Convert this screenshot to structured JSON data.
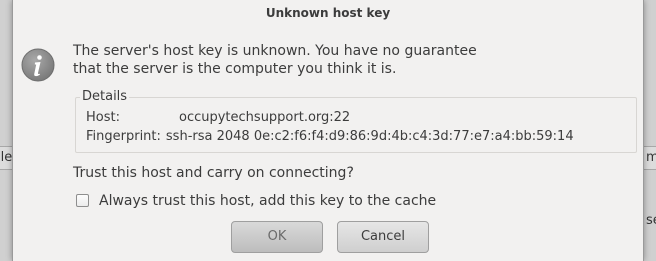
{
  "dialog": {
    "title": "Unknown host key",
    "message_line1": "The server's host key is unknown. You have no guarantee",
    "message_line2": "that the server is the computer you think it is.",
    "details": {
      "legend": "Details",
      "host_label": "Host:",
      "host_value": "occupytechsupport.org:22",
      "fingerprint_label": "Fingerprint:",
      "fingerprint_value": "ssh-rsa 2048 0e:c2:f6:f4:d9:86:9d:4b:c4:3d:77:e7:a4:bb:59:14"
    },
    "trust_question": "Trust this host and carry on connecting?",
    "always_trust": {
      "label": "Always trust this host, add this key to the cache",
      "checked": false
    },
    "buttons": {
      "ok": "OK",
      "cancel": "Cancel"
    },
    "icon": "info-icon"
  },
  "background": {
    "left_edge_text": "ile",
    "right_edge_text": "m",
    "right_lower_text": "se"
  },
  "colors": {
    "dialog_bg": "#f2f1f0",
    "text": "#3c3c3c",
    "icon_bg": "#8a8a8a"
  }
}
